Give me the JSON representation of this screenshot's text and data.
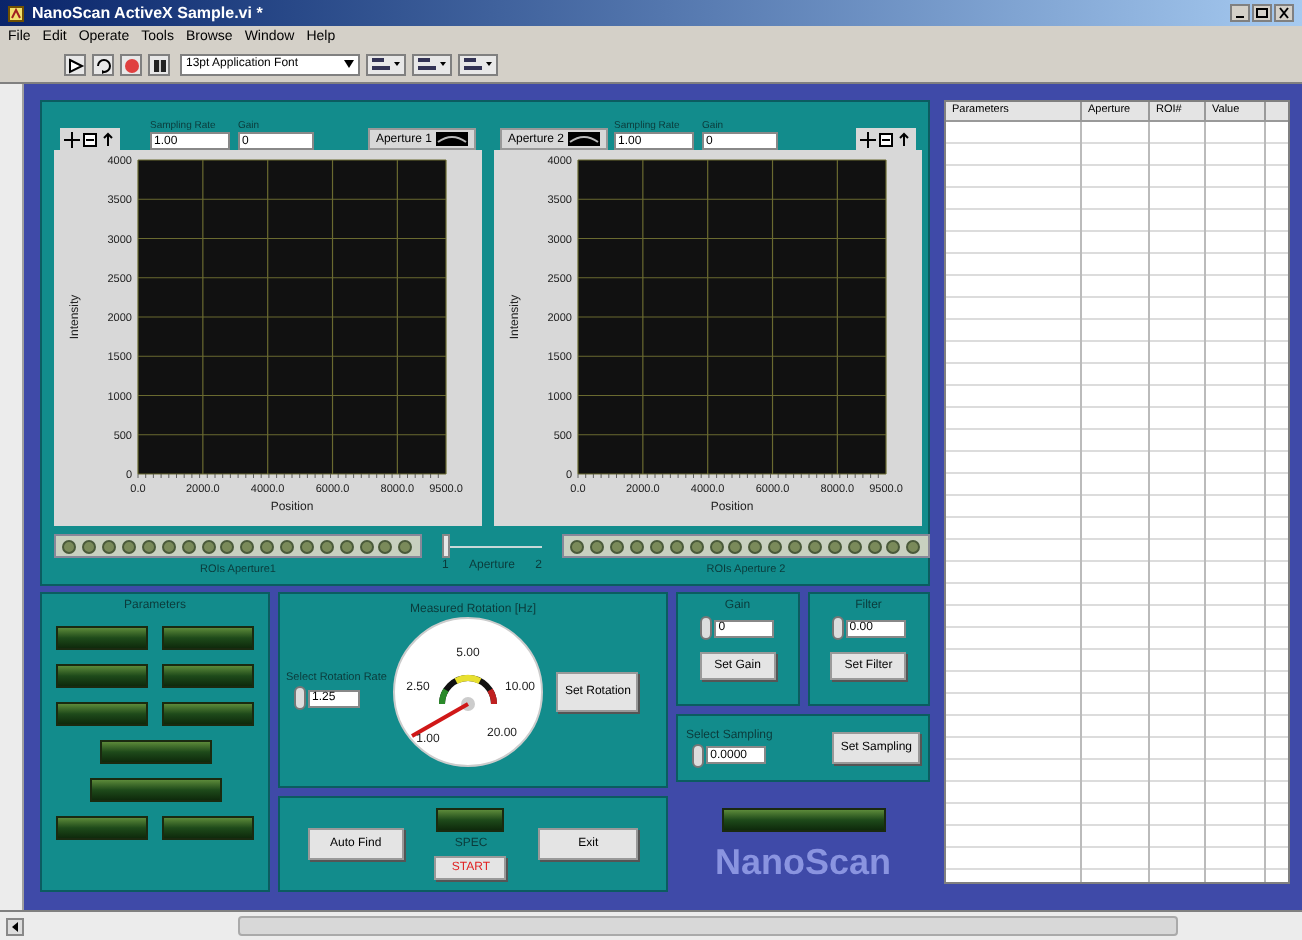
{
  "window": {
    "title": "NanoScan ActiveX Sample.vi *"
  },
  "menu": [
    "File",
    "Edit",
    "Operate",
    "Tools",
    "Browse",
    "Window",
    "Help"
  ],
  "toolbar": {
    "font": "13pt Application Font"
  },
  "graphs": [
    {
      "aperture_label": "Aperture 1",
      "fields": [
        {
          "label": "Sampling Rate",
          "value": "1.00"
        },
        {
          "label": "Gain",
          "value": "0"
        }
      ],
      "chart_data": {
        "type": "line",
        "grid": true,
        "xlabel": "Position",
        "ylabel": "Intensity",
        "xlim": [
          0,
          9500
        ],
        "ylim": [
          0,
          4000
        ],
        "xticks": [
          {
            "value": 0,
            "label": "0.0"
          },
          {
            "value": 2000,
            "label": "2000.0"
          },
          {
            "value": 4000,
            "label": "4000.0"
          },
          {
            "value": 6000,
            "label": "6000.0"
          },
          {
            "value": 8000,
            "label": "8000.0"
          },
          {
            "value": 9500,
            "label": "9500.0"
          }
        ],
        "yticks": [
          0,
          500,
          1000,
          1500,
          2000,
          2500,
          3000,
          3500,
          4000
        ]
      }
    },
    {
      "aperture_label": "Aperture 2",
      "fields": [
        {
          "label": "Sampling Rate",
          "value": "1.00"
        },
        {
          "label": "Gain",
          "value": "0"
        }
      ],
      "chart_data": {
        "type": "line",
        "grid": true,
        "xlabel": "Position",
        "ylabel": "Intensity",
        "xlim": [
          0,
          9500
        ],
        "ylim": [
          0,
          4000
        ],
        "xticks": [
          {
            "value": 0,
            "label": "0.0"
          },
          {
            "value": 2000,
            "label": "2000.0"
          },
          {
            "value": 4000,
            "label": "4000.0"
          },
          {
            "value": 6000,
            "label": "6000.0"
          },
          {
            "value": 8000,
            "label": "8000.0"
          },
          {
            "value": 9500,
            "label": "9500.0"
          }
        ],
        "yticks": [
          0,
          500,
          1000,
          1500,
          2000,
          2500,
          3000,
          3500,
          4000
        ]
      }
    }
  ],
  "roi_strips": [
    {
      "label": "ROIs Aperture1"
    },
    {
      "label": "ROIs Aperture 2"
    }
  ],
  "aperture_slider": {
    "label": "Aperture",
    "min_label": "1",
    "max_label": "2",
    "level": 0
  },
  "parameters": {
    "title": "Parameters"
  },
  "rotation": {
    "title": "Measured Rotation [Hz]",
    "gauge_labels": [
      "1.00",
      "2.50",
      "5.00",
      "10.00",
      "20.00"
    ],
    "select_label": "Select Rotation Rate",
    "select_value": "1.25",
    "button": "Set Rotation"
  },
  "actions": {
    "auto_find": "Auto Find",
    "status_label": "SPEC",
    "start": "START",
    "exit": "Exit"
  },
  "gain": {
    "label": "Gain",
    "value": "0",
    "button": "Set Gain"
  },
  "filter": {
    "label": "Filter",
    "value": "0.00",
    "button": "Set Filter"
  },
  "sampling": {
    "label": "Select Sampling",
    "value": "0.0000",
    "button": "Set Sampling"
  },
  "logo": "NanoScan",
  "table": {
    "columns": [
      "Parameters",
      "Aperture",
      "ROI#",
      "Value"
    ]
  }
}
